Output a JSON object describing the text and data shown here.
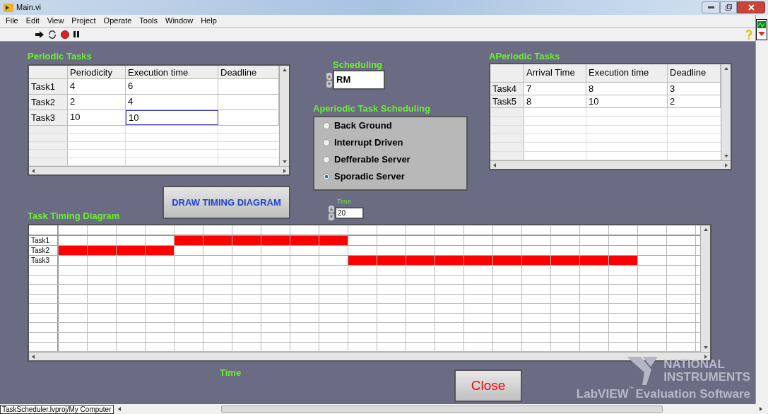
{
  "window": {
    "title": "Main.vi"
  },
  "menu": [
    "File",
    "Edit",
    "View",
    "Project",
    "Operate",
    "Tools",
    "Window",
    "Help"
  ],
  "periodic_tasks": {
    "label": "Periodic Tasks",
    "columns": [
      "Periodicity",
      "Execution time",
      "Deadline"
    ],
    "rows": [
      {
        "header": "Task1",
        "cells": [
          {
            "text": "4",
            "selected": false
          },
          {
            "text": "6",
            "selected": false
          }
        ]
      },
      {
        "header": "Task2",
        "cells": [
          {
            "text": "2",
            "selected": false
          },
          {
            "text": "4",
            "selected": false
          }
        ]
      },
      {
        "header": "Task3",
        "cells": [
          {
            "text": "10",
            "selected": false
          },
          {
            "text": "10",
            "selected": true
          }
        ]
      }
    ]
  },
  "scheduling": {
    "label": "Scheduling",
    "value": "RM"
  },
  "aperiodic_scheduling": {
    "label": "Aperiodic Task Scheduling",
    "options": [
      {
        "label": "Back Ground",
        "selected": false
      },
      {
        "label": "Interrupt Driven",
        "selected": false
      },
      {
        "label": "Defferable Server",
        "selected": false
      },
      {
        "label": "Sporadic Server",
        "selected": true
      }
    ]
  },
  "aperiodic_tasks": {
    "label": "APeriodic Tasks",
    "columns": [
      "Arrival Time",
      "Execution time",
      "Deadline"
    ],
    "rows": [
      {
        "header": "Task4",
        "cells": [
          "7",
          "8",
          "3"
        ]
      },
      {
        "header": "Task5",
        "cells": [
          "8",
          "10",
          "2"
        ]
      }
    ]
  },
  "draw_button": "DRAW TIMING DIAGRAM",
  "time": {
    "label": "Time",
    "value": "20"
  },
  "timing_diagram": {
    "label": "Task Timing Diagram",
    "axis_label": "Time",
    "rows": [
      {
        "label": "Task1",
        "filled": [
          false,
          false,
          false,
          false,
          true,
          true,
          true,
          true,
          true,
          true,
          false,
          false,
          false,
          false,
          false,
          false,
          false,
          false,
          false,
          false,
          false,
          false
        ]
      },
      {
        "label": "Task2",
        "filled": [
          true,
          true,
          true,
          true,
          false,
          false,
          false,
          false,
          false,
          false,
          false,
          false,
          false,
          false,
          false,
          false,
          false,
          false,
          false,
          false,
          false,
          false
        ]
      },
      {
        "label": "Task3",
        "filled": [
          false,
          false,
          false,
          false,
          false,
          false,
          false,
          false,
          false,
          false,
          true,
          true,
          true,
          true,
          true,
          true,
          true,
          true,
          true,
          true,
          false,
          false
        ]
      }
    ]
  },
  "close_button": "Close",
  "branding": {
    "line1": "NATIONAL",
    "line2": "INSTRUMENTS",
    "product": "LabVIEW",
    "tm": "™",
    "edition": "Evaluation Software"
  },
  "status_bar": {
    "path": "TaskScheduler.lvproj/My Computer"
  }
}
